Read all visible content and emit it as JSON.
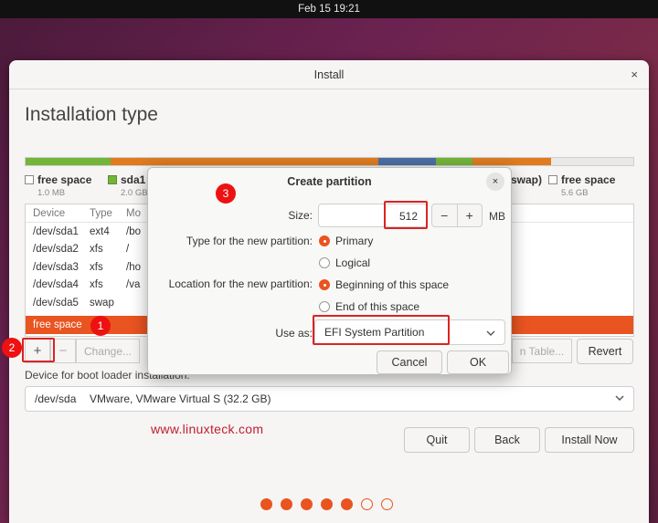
{
  "topbar": {
    "datetime": "Feb 15  19:21"
  },
  "window": {
    "title": "Install",
    "close": "×",
    "heading": "Installation type"
  },
  "diskbar_colors": [
    "#73b539",
    "#e07b20",
    "#4a6fa5",
    "#73b539",
    "#e07b20",
    "#e8e8e8"
  ],
  "legend": [
    {
      "label": "free space",
      "size": "1.0 MB",
      "kind": "free"
    },
    {
      "label": "sda1",
      "size": "2.0 GB",
      "kind": "green"
    },
    {
      "label": "swap)",
      "size": "",
      "kind": "none"
    },
    {
      "label": "free space",
      "size": "5.6 GB",
      "kind": "free"
    }
  ],
  "table": {
    "headers": [
      "Device",
      "Type",
      "Mo"
    ],
    "rows": [
      [
        "/dev/sda1",
        "ext4",
        "/bo"
      ],
      [
        "/dev/sda2",
        "xfs",
        "/"
      ],
      [
        "/dev/sda3",
        "xfs",
        "/ho"
      ],
      [
        "/dev/sda4",
        "xfs",
        "/va"
      ],
      [
        "/dev/sda5",
        "swap",
        ""
      ]
    ],
    "selected": "free space"
  },
  "buttons": {
    "add": "+",
    "remove": "−",
    "change": "Change...",
    "new_table": "n Table...",
    "revert": "Revert",
    "quit": "Quit",
    "back": "Back",
    "install": "Install Now"
  },
  "boot": {
    "label": "Device for boot loader installation:",
    "device": "/dev/sda",
    "description": "VMware, VMware Virtual S (32.2 GB)"
  },
  "watermark": "www.linuxteck.com",
  "progress": {
    "done": 5,
    "total": 7
  },
  "dialog": {
    "title": "Create partition",
    "close": "×",
    "size_label": "Size:",
    "size_value": "512",
    "minus": "−",
    "plus": "+",
    "unit": "MB",
    "type_label": "Type for the new partition:",
    "type_options": [
      "Primary",
      "Logical"
    ],
    "location_label": "Location for the new partition:",
    "location_options": [
      "Beginning of this space",
      "End of this space"
    ],
    "useas_label": "Use as:",
    "useas_value": "EFI System Partition",
    "cancel": "Cancel",
    "ok": "OK"
  },
  "markers": [
    "1",
    "2",
    "3"
  ],
  "accent": "#e95420",
  "annotation_red": "#dd2222"
}
